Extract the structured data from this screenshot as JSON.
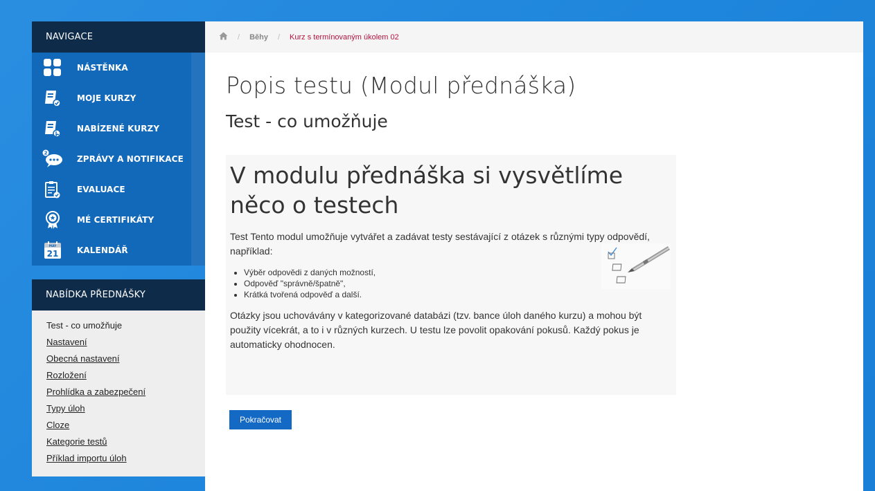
{
  "navigation": {
    "header": "NAVIGACE",
    "items": [
      {
        "label": "NÁSTĚNKA",
        "icon": "dashboard-grid-icon"
      },
      {
        "label": "MOJE KURZY",
        "icon": "book-check-icon"
      },
      {
        "label": "NABÍZENÉ KURZY",
        "icon": "book-cursor-icon"
      },
      {
        "label": "ZPRÁVY A NOTIFIKACE",
        "icon": "chat-bubble-icon",
        "badge": "2"
      },
      {
        "label": "EVALUACE",
        "icon": "clipboard-check-icon"
      },
      {
        "label": "MÉ CERTIFIKÁTY",
        "icon": "award-icon"
      },
      {
        "label": "KALENDÁŘ",
        "icon": "calendar-icon",
        "month": "MAY",
        "day": "21"
      }
    ]
  },
  "lecture_menu": {
    "header": "NABÍDKA PŘEDNÁŠKY",
    "items": [
      "Test - co umožňuje",
      "Nastavení",
      "Obecná nastavení",
      "Rozložení",
      "Prohlídka a zabezpečení",
      "Typy úloh",
      "Cloze",
      "Kategorie testů",
      "Příklad importu úloh"
    ]
  },
  "breadcrumb": {
    "home_icon": "home-icon",
    "sep": "/",
    "link": "Běhy",
    "current": "Kurz s termínovaným úkolem 02"
  },
  "page": {
    "title": "Popis testu (Modul přednáška)",
    "subtitle": "Test - co umožňuje",
    "heading": "V modulu přednáška si vysvětlíme něco o testech",
    "intro": "Test Tento modul umožňuje vytvářet a zadávat testy sestávající z otázek s různými typy odpovědí, například:",
    "bullets": [
      "Výběr odpovědi z daných možností,",
      "Odpověď \"správně/špatně\",",
      "Krátká tvořená odpověď a další."
    ],
    "paragraph": "Otázky jsou uchovávány v kategorizované databázi (tzv. bance úloh daného kurzu) a mohou být použity vícekrát, a to i v různých kurzech. U testu lze povolit opakování pokusů. Každý pokus je automaticky ohodnocen.",
    "button": "Pokračovat"
  }
}
